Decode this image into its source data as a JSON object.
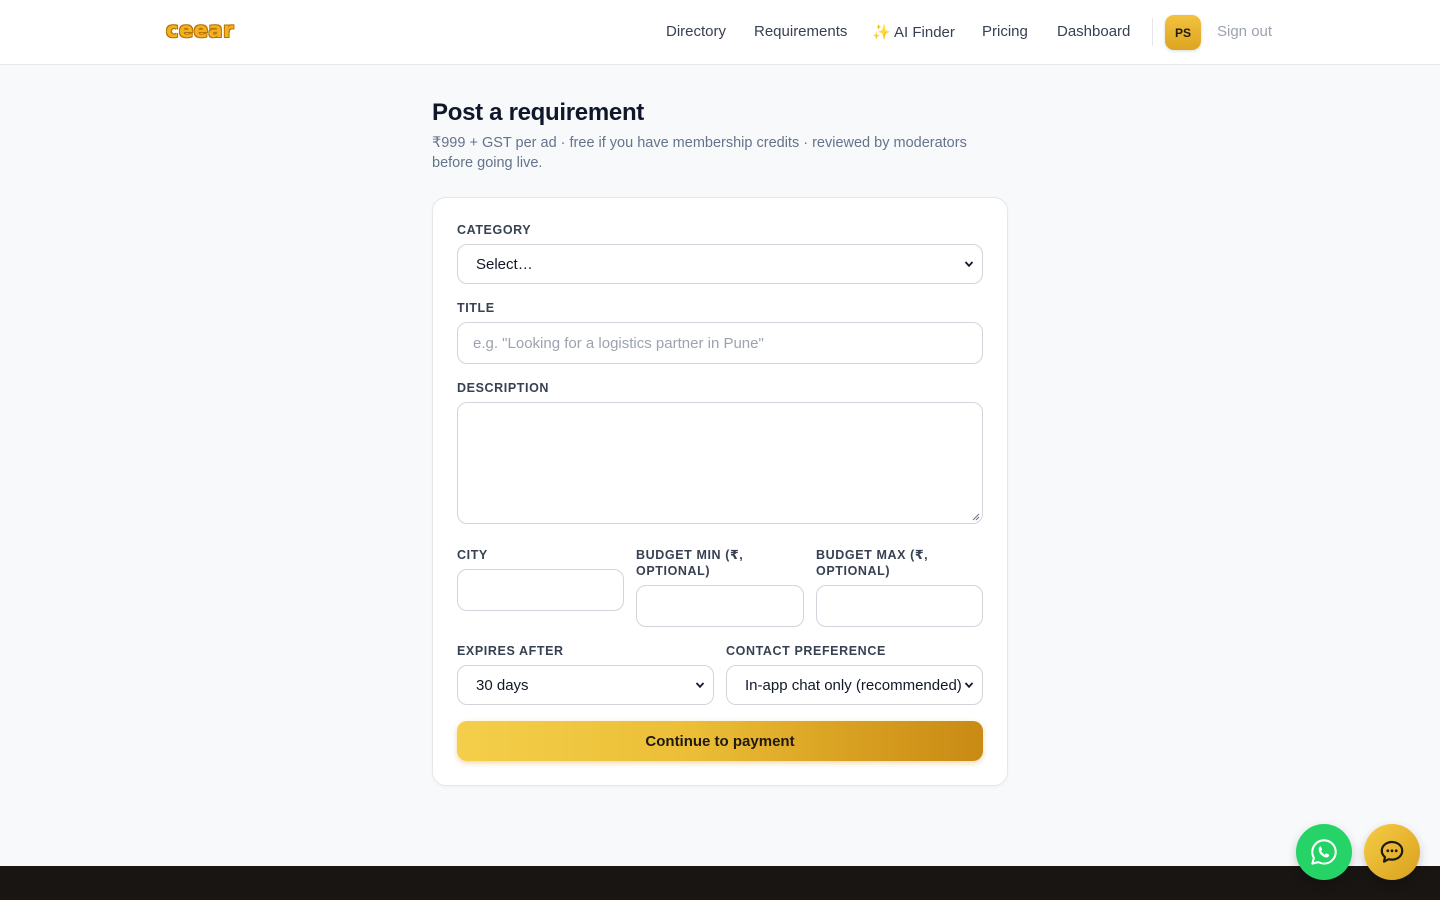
{
  "brand": {
    "logo_text": "ceear"
  },
  "nav": {
    "directory": "Directory",
    "requirements": "Requirements",
    "ai_finder": "✨ AI Finder",
    "pricing": "Pricing",
    "dashboard": "Dashboard",
    "avatar_initials": "PS",
    "sign_out": "Sign out"
  },
  "page": {
    "title": "Post a requirement",
    "subtitle": "₹999 + GST per ad · free if you have membership credits · reviewed by moderators before going live."
  },
  "form": {
    "category": {
      "label": "Category",
      "value": "Select…"
    },
    "title": {
      "label": "Title",
      "placeholder": "e.g. \"Looking for a logistics partner in Pune\"",
      "value": ""
    },
    "description": {
      "label": "Description",
      "value": ""
    },
    "city": {
      "label": "City",
      "value": ""
    },
    "budget_min": {
      "label": "Budget min (₹, optional)",
      "value": ""
    },
    "budget_max": {
      "label": "Budget max (₹, optional)",
      "value": ""
    },
    "expires_after": {
      "label": "Expires after",
      "value": "30 days"
    },
    "contact_preference": {
      "label": "Contact preference",
      "value": "In-app chat only (recommended)"
    },
    "submit_label": "Continue to payment"
  },
  "floating": {
    "whatsapp_icon": "whatsapp-icon",
    "chat_icon": "chat-bubble-icon"
  },
  "colors": {
    "accent": "#e9b934",
    "accent_dark": "#c98a14",
    "whatsapp": "#25d366",
    "footer": "#181513"
  }
}
